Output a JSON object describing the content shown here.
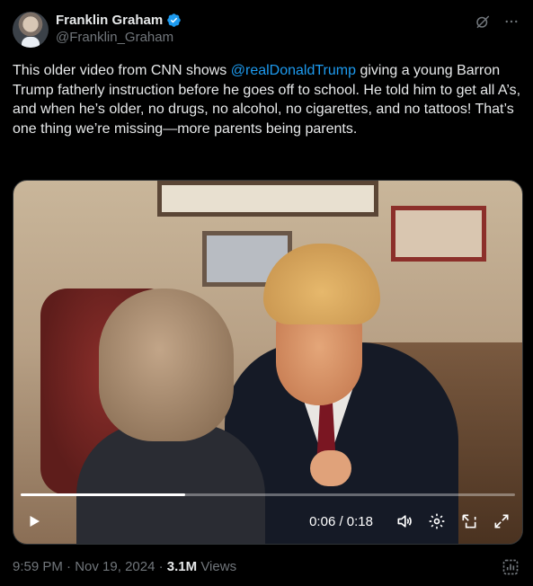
{
  "author": {
    "display_name": "Franklin Graham",
    "handle": "@Franklin_Graham",
    "verified": true,
    "verified_color": "#1d9bf0"
  },
  "tweet": {
    "text_before": "This older video from CNN shows ",
    "mention": "@realDonaldTrump",
    "text_after": " giving a young Barron Trump fatherly instruction before he goes off to school. He told him to get all A’s, and when he’s older, no drugs, no alcohol, no cigarettes, and no tattoos! That’s one thing we’re missing—more parents being parents."
  },
  "video": {
    "current_time": "0:06",
    "duration": "0:18",
    "time_display": "0:06 / 0:18",
    "progress": 0.333
  },
  "footer": {
    "time": "9:59 PM",
    "sep1": " · ",
    "date": "Nov 19, 2024",
    "sep2": " · ",
    "views_count": "3.1M",
    "views_label": " Views"
  },
  "colors": {
    "background": "#000000",
    "text": "#e7e9ea",
    "secondary": "#71767b",
    "link": "#1d9bf0"
  },
  "icons": [
    "grok-icon",
    "more-icon",
    "verified-badge-icon",
    "play-icon",
    "volume-icon",
    "settings-icon",
    "pip-icon",
    "fullscreen-icon",
    "analytics-icon"
  ]
}
